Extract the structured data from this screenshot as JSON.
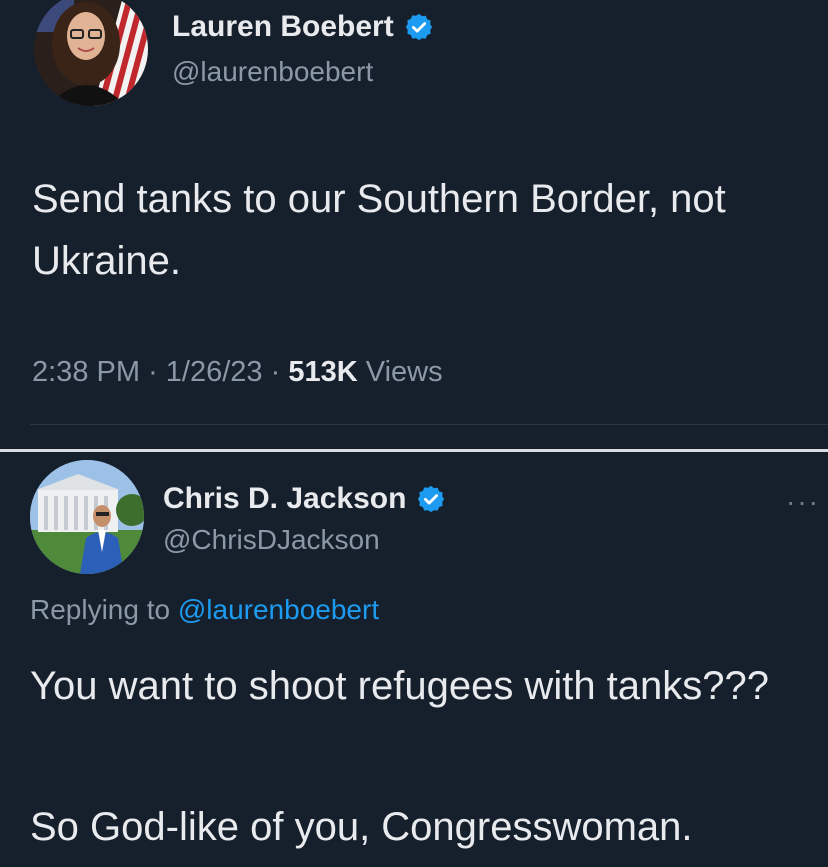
{
  "tweet": {
    "author_name": "Lauren Boebert",
    "author_handle": "@laurenboebert",
    "text": "Send tanks to our Southern Border, not Ukraine.",
    "time": "2:38 PM",
    "separator": "·",
    "date": "1/26/23",
    "views_count": "513K",
    "views_label": "Views"
  },
  "reply": {
    "author_name": "Chris D. Jackson",
    "author_handle": "@ChrisDJackson",
    "more_label": "···",
    "replying_prefix": "Replying to",
    "replying_handle": "@laurenboebert",
    "text_1": "You want to shoot refugees with tanks???",
    "text_2": "So God-like of you, Congresswoman."
  },
  "colors": {
    "background": "#16202c",
    "primary_text": "#e8eaed",
    "secondary_text": "#8b98a5",
    "link": "#1d9bf0",
    "verified": "#1d9bf0"
  },
  "icons": {
    "verified": "verified-badge-icon",
    "more": "more-options-icon"
  }
}
